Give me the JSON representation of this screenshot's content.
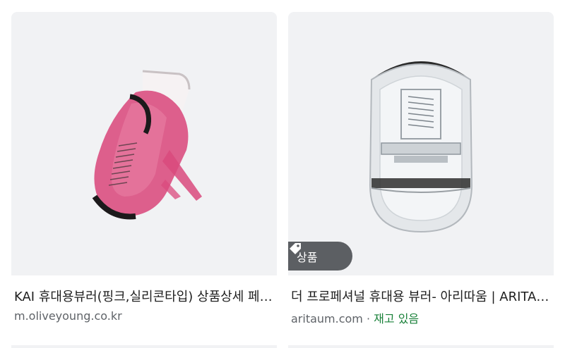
{
  "results": [
    {
      "title": "KAI 휴대용뷰러(핑크,실리콘타입) 상품상세 페이지",
      "source": "m.oliveyoung.co.kr",
      "stock": "",
      "badge": ""
    },
    {
      "title": "더 프로페셔널 휴대용 뷰러- 아리따움 | ARITAUM",
      "source": "aritaum.com",
      "stock": "재고 있음",
      "badge": "상품",
      "separator": "·"
    }
  ],
  "icons": {
    "badge_icon": "tag-icon"
  },
  "colors": {
    "tile_bg": "#f1f2f4",
    "badge_bg": "#5c5f63",
    "title_text": "#1f1f1f",
    "source_text": "#5f6368",
    "stock_text": "#188038",
    "curler_pink": "#d94a7d"
  }
}
